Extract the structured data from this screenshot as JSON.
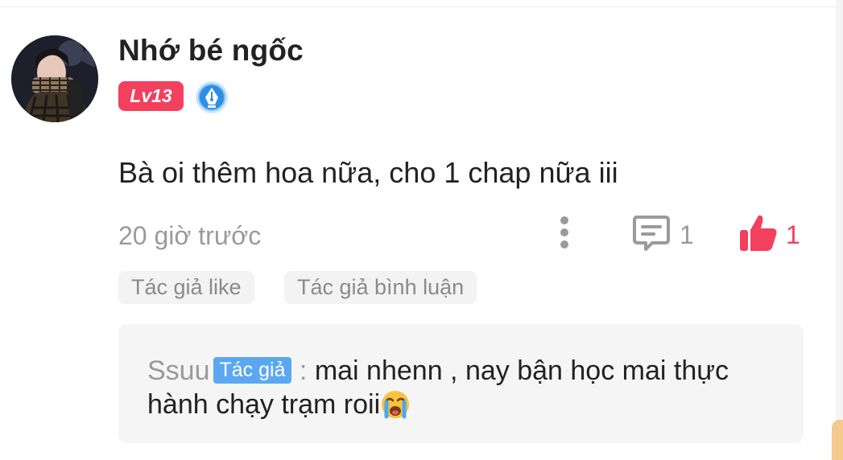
{
  "comment": {
    "username": "Nhớ bé ngốc",
    "level": "Lv13",
    "text": "Bà oi thêm hoa nữa, cho 1 chap nữa iii",
    "timestamp": "20 giờ trước",
    "reply_count": "1",
    "like_count": "1"
  },
  "tags": {
    "author_like": "Tác giả like",
    "author_comment": "Tác giả bình luận"
  },
  "reply": {
    "author": "Ssuu",
    "author_badge": "Tác giả",
    "separator": " : ",
    "text": "mai nhenn , nay bận học mai thực hành chạy trạm roii"
  },
  "colors": {
    "accent_red": "#f2405e",
    "author_blue": "#5ba8f0",
    "muted_text": "#9a9a9a"
  },
  "icons": {
    "more": "more-vertical-icon",
    "reply": "comment-bubble-icon",
    "like": "thumbs-up-icon",
    "badge": "pen-nib-badge-icon",
    "emoji": "loudly-crying-face-emoji"
  }
}
